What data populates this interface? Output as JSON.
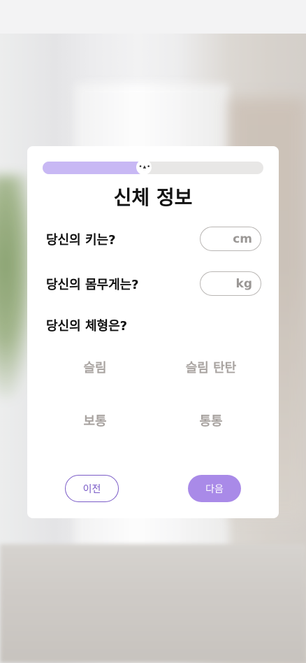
{
  "progress": {
    "value_fraction": 0.46,
    "knob_glyph": "• ▴ •"
  },
  "title": "신체 정보",
  "questions": {
    "height": {
      "label": "당신의 키는?",
      "unit": "cm"
    },
    "weight": {
      "label": "당신의 몸무게는?",
      "unit": "kg"
    },
    "body_type": {
      "label": "당신의 체형은?"
    }
  },
  "body_types": [
    "슬림",
    "슬림 탄탄",
    "보통",
    "통통"
  ],
  "buttons": {
    "prev": "이전",
    "next": "다음"
  },
  "colors": {
    "accent": "#a98ae8",
    "progress_fill": "#c8b8f4",
    "outline": "#7a5bc7"
  }
}
